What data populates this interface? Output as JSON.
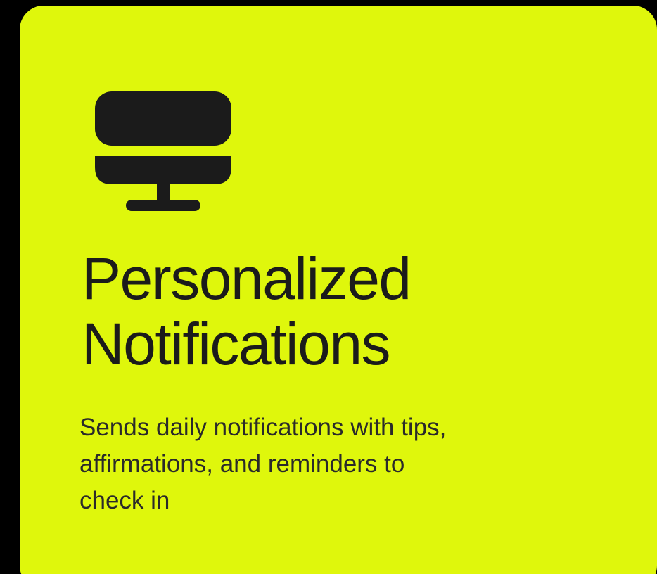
{
  "card": {
    "icon": "desktop-monitor-icon",
    "title_lines": [
      "Personalized",
      "Notifications"
    ],
    "description_lines": [
      "Sends daily notifications with tips,",
      "affirmations, and reminders to",
      "check in"
    ]
  },
  "colors": {
    "page_background": "#000000",
    "card_background": "#dff70c",
    "text": "#1b1b1b"
  }
}
